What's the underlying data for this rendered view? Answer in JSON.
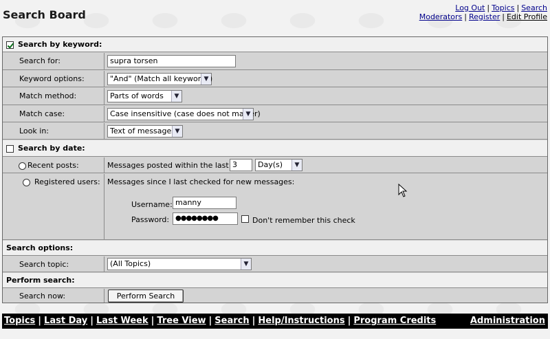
{
  "header": {
    "title": "Search Board",
    "links_row1": [
      "Log Out",
      "Topics",
      "Search"
    ],
    "links_row2": [
      "Moderators",
      "Register",
      "Edit Profile"
    ],
    "separator": "|"
  },
  "keyword_section": {
    "title": "Search by keyword:",
    "checked": true,
    "search_for_label": "Search for:",
    "search_for_value": "supra torsen",
    "keyword_options_label": "Keyword options:",
    "keyword_options_value": "\"And\" (Match all keywords)",
    "match_method_label": "Match method:",
    "match_method_value": "Parts of words",
    "match_case_label": "Match case:",
    "match_case_value": "Case insensitive (case does not matter)",
    "look_in_label": "Look in:",
    "look_in_value": "Text of messages"
  },
  "date_section": {
    "title": "Search by date:",
    "checked": false,
    "recent_label": "Recent posts:",
    "recent_text": "Messages posted within the last",
    "recent_count": "3",
    "recent_unit": "Day(s)",
    "registered_label": "Registered users:",
    "registered_text": "Messages since I last checked for new messages:",
    "username_label": "Username:",
    "username_value": "manny",
    "password_label": "Password:",
    "password_value": "●●●●●●●●",
    "dont_remember_label": "Don't remember this check"
  },
  "search_options": {
    "title": "Search options:",
    "topic_label": "Search topic:",
    "topic_value": "(All Topics)"
  },
  "perform": {
    "title": "Perform search:",
    "now_label": "Search now:",
    "button_label": "Perform Search"
  },
  "footer": {
    "links": [
      "Topics",
      "Last Day",
      "Last Week",
      "Tree View",
      "Search",
      "Help/Instructions",
      "Program Credits"
    ],
    "admin": "Administration",
    "separator": "|"
  },
  "colors": {
    "link": "#00008b",
    "form_bg": "#d4d4d4",
    "section_bg": "#f0f0f0",
    "footer_bg": "#000000"
  }
}
